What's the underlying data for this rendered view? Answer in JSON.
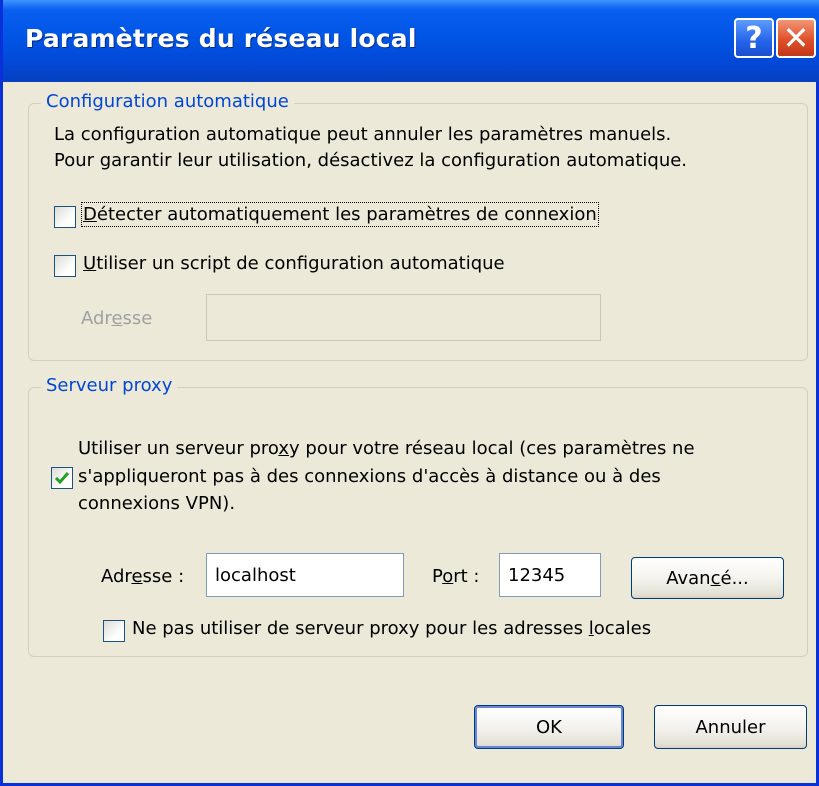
{
  "window": {
    "title": "Paramètres du réseau local",
    "help_label": "?",
    "close_label": "✕"
  },
  "auto_config": {
    "legend": "Configuration automatique",
    "description_line1": "La configuration automatique peut annuler les paramètres manuels.",
    "description_line2": "Pour garantir leur utilisation, désactivez la configuration automatique.",
    "detect_checkbox": {
      "label_pre": "",
      "label_ul": "D",
      "label_post": "étecter automatiquement les paramètres de connexion",
      "checked": false
    },
    "script_checkbox": {
      "label_pre": "",
      "label_ul": "U",
      "label_post": "tiliser un script de configuration automatique",
      "checked": false
    },
    "address": {
      "label_pre": "Adr",
      "label_ul": "e",
      "label_post": "sse",
      "value": ""
    }
  },
  "proxy": {
    "legend": "Serveur proxy",
    "use_proxy_checkbox": {
      "line1_pre": "Utiliser un serveur pro",
      "line1_ul": "x",
      "line1_post": "y pour votre réseau local (ces paramètres ne",
      "line2": "s'appliqueront pas à des connexions d'accès à distance ou à des",
      "line3": "connexions VPN).",
      "checked": true
    },
    "address": {
      "label_pre": "Adr",
      "label_ul": "e",
      "label_post": "sse :",
      "value": "localhost"
    },
    "port": {
      "label_pre": "P",
      "label_ul": "o",
      "label_post": "rt :",
      "value": "12345"
    },
    "advanced_button": {
      "label_pre": "Avan",
      "label_ul": "c",
      "label_post": "é..."
    },
    "bypass_checkbox": {
      "label_pre": "Ne pas utiliser de serveur proxy pour les adresses ",
      "label_ul": "l",
      "label_post": "ocales",
      "checked": false
    }
  },
  "buttons": {
    "ok": "OK",
    "cancel": "Annuler"
  }
}
